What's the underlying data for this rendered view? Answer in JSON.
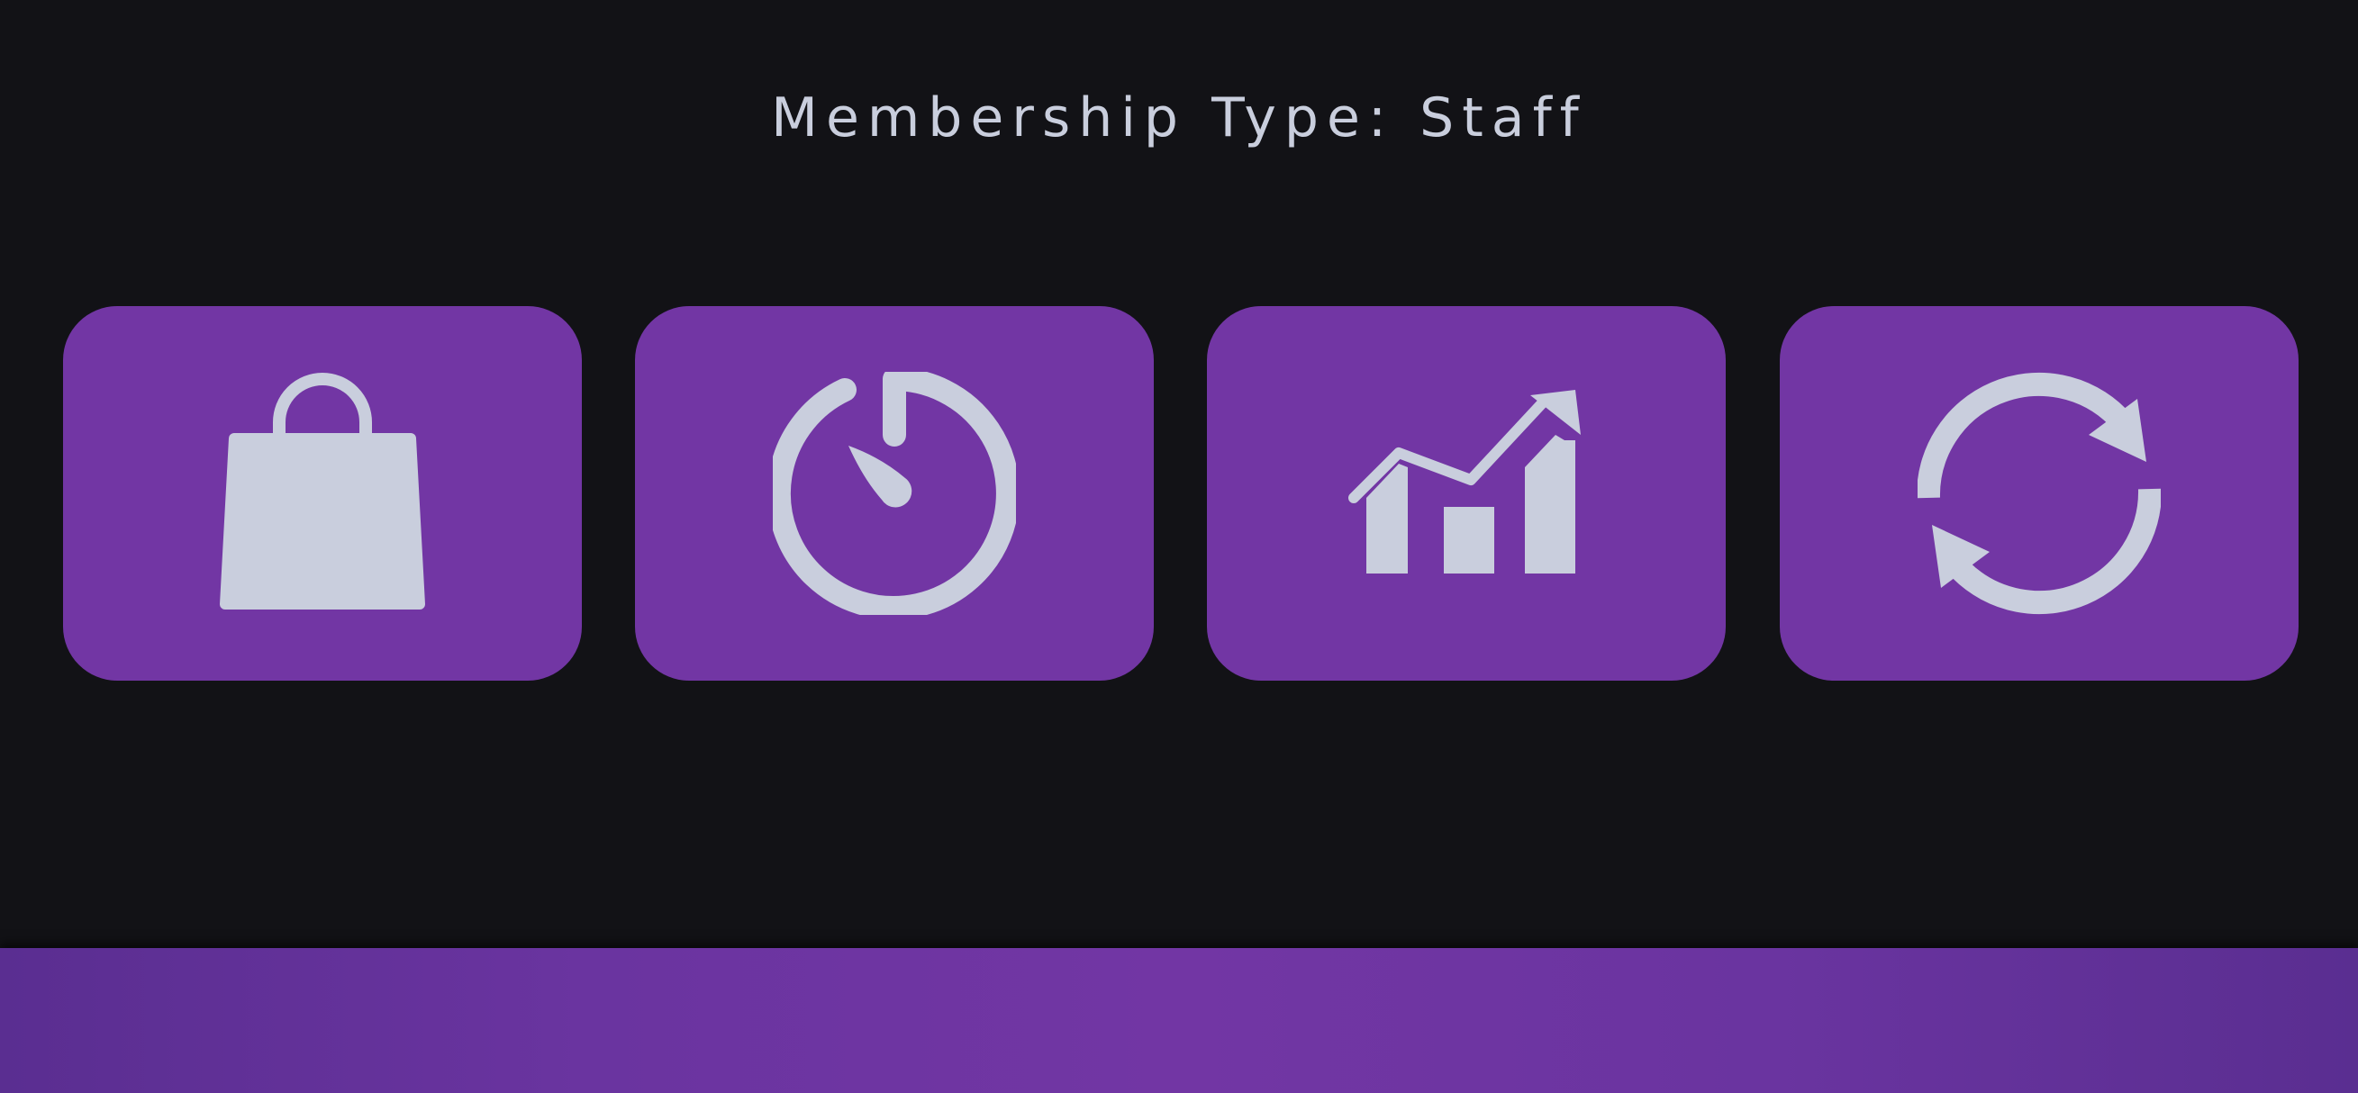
{
  "header": {
    "title": "Membership Type: Staff"
  },
  "tiles": [
    {
      "icon": "shopping-bag-icon"
    },
    {
      "icon": "stopwatch-icon"
    },
    {
      "icon": "growth-chart-icon"
    },
    {
      "icon": "refresh-icon"
    }
  ],
  "colors": {
    "background": "#121216",
    "tile": "#7236a4",
    "icon": "#c9cedd",
    "title_text": "#c9cedd",
    "footer": "#6a34a0"
  }
}
